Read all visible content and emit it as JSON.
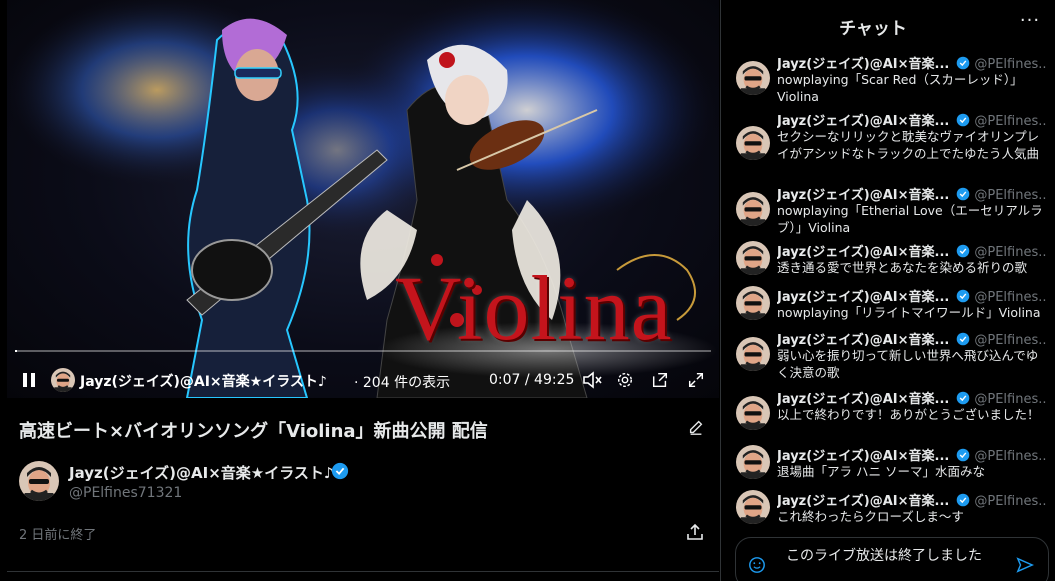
{
  "video": {
    "art_title": "Violina",
    "progress_fraction": 0.0024,
    "controls": {
      "author": "Jayz(ジェイズ)@AI×音楽★イラスト♪",
      "views": "· 204 件の表示",
      "time": "0:07 / 49:25"
    },
    "icons": [
      "pause-icon",
      "mute-icon",
      "gear-icon",
      "popout-icon",
      "fullscreen-icon"
    ]
  },
  "info": {
    "title": "高速ビート×バイオリンソング「Violina」新曲公開 配信",
    "host_name": "Jayz(ジェイズ)@AI×音楽★イラスト♪",
    "host_handle": "@PElfines71321",
    "ended": "2 日前に終了"
  },
  "chat": {
    "title": "チャット",
    "more": "···",
    "messages": [
      {
        "name": "Jayz(ジェイズ)@AI×音楽...",
        "handle": "@PElfines...",
        "text": "nowplaying「Scar Red（スカーレッド）」Violina"
      },
      {
        "name": "Jayz(ジェイズ)@AI×音楽...",
        "handle": "@PElfines...",
        "text": "セクシーなリリックと耽美なヴァイオリンプレイがアシッドなトラックの上でたゆたう人気曲"
      },
      {
        "name": "Jayz(ジェイズ)@AI×音楽...",
        "handle": "@PElfines...",
        "text": "nowplaying「Etherial Love（エーセリアルラブ）」Violina"
      },
      {
        "name": "Jayz(ジェイズ)@AI×音楽...",
        "handle": "@PElfines...",
        "text": "透き通る愛で世界とあなたを染める祈りの歌"
      },
      {
        "name": "Jayz(ジェイズ)@AI×音楽...",
        "handle": "@PElfines...",
        "text": "nowplaying「リライトマイワールド」Violina"
      },
      {
        "name": "Jayz(ジェイズ)@AI×音楽...",
        "handle": "@PElfines...",
        "text": "弱い心を振り切って新しい世界へ飛び込んでゆく決意の歌"
      },
      {
        "name": "Jayz(ジェイズ)@AI×音楽...",
        "handle": "@PElfines...",
        "text": "以上で終わりです！ありがとうございました！"
      },
      {
        "name": "Jayz(ジェイズ)@AI×音楽...",
        "handle": "@PElfines...",
        "text": "退場曲「アラ ハニ ソーマ」水面みな"
      },
      {
        "name": "Jayz(ジェイズ)@AI×音楽...",
        "handle": "@PElfines...",
        "text": "これ終わったらクローズしま〜す"
      }
    ],
    "input_text": "このライブ放送は終了しました"
  },
  "colors": {
    "accent": "#1d9bf0",
    "muted": "#71767b",
    "text": "#e7e9ea",
    "art_red": "#c4141c"
  }
}
